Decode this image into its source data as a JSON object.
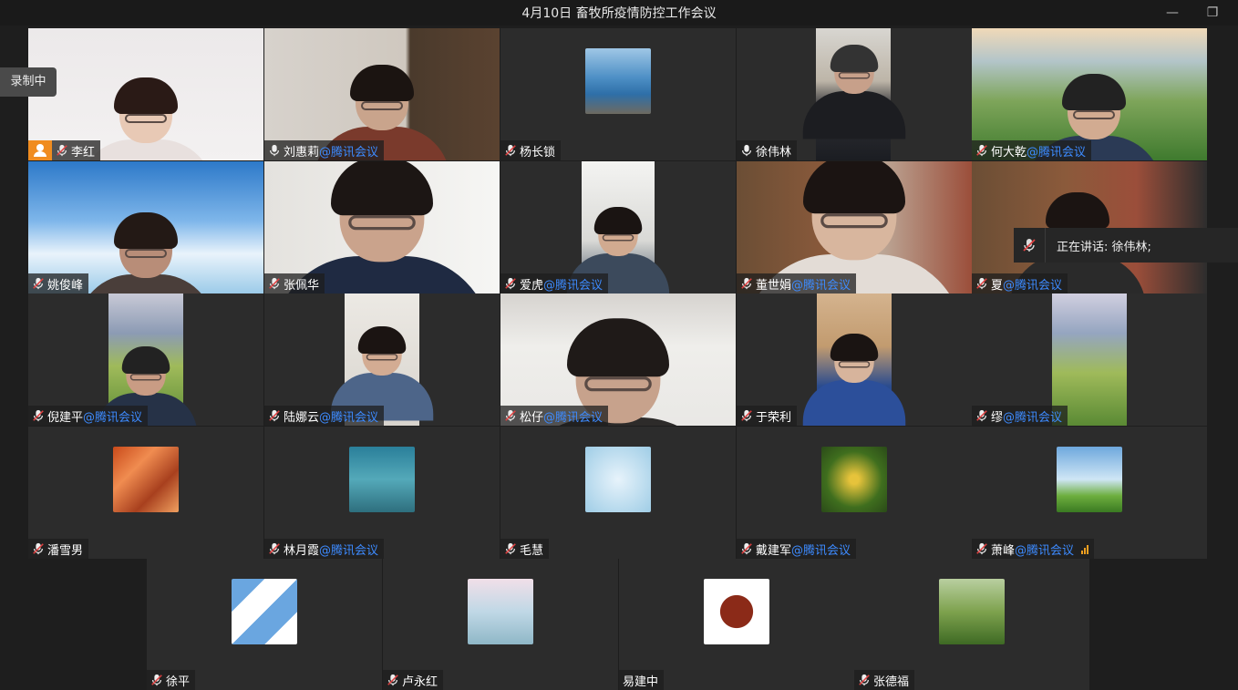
{
  "window": {
    "title": "4月10日 畜牧所疫情防控工作会议",
    "minimize_icon": "—",
    "restore_icon": "❐"
  },
  "recording": {
    "label": "录制中"
  },
  "speaking": {
    "text": "正在讲话: 徐伟林;"
  },
  "colors": {
    "active_border": "#20c36b",
    "suffix": "#3d8bff",
    "host_badge": "#f08c1f"
  },
  "participants": [
    {
      "name": "李红",
      "suffix": "",
      "mic": "muted",
      "host": true
    },
    {
      "name": "刘惠莉",
      "suffix": "@腾讯会议",
      "mic": "on"
    },
    {
      "name": "杨长锁",
      "suffix": "",
      "mic": "muted"
    },
    {
      "name": "徐伟林",
      "suffix": "",
      "mic": "on",
      "active": true
    },
    {
      "name": "何大乾",
      "suffix": "@腾讯会议",
      "mic": "muted"
    },
    {
      "name": "姚俊峰",
      "suffix": "",
      "mic": "muted"
    },
    {
      "name": "张佩华",
      "suffix": "",
      "mic": "muted"
    },
    {
      "name": "爱虎",
      "suffix": "@腾讯会议",
      "mic": "muted"
    },
    {
      "name": "董世娟",
      "suffix": "@腾讯会议",
      "mic": "muted"
    },
    {
      "name": "夏",
      "suffix": "@腾讯会议",
      "mic": "muted"
    },
    {
      "name": "倪建平",
      "suffix": "@腾讯会议",
      "mic": "muted"
    },
    {
      "name": "陆娜云",
      "suffix": "@腾讯会议",
      "mic": "muted"
    },
    {
      "name": "松仔",
      "suffix": "@腾讯会议",
      "mic": "muted"
    },
    {
      "name": "于荣利",
      "suffix": "",
      "mic": "muted"
    },
    {
      "name": "缪",
      "suffix": "@腾讯会议",
      "mic": "muted"
    },
    {
      "name": "潘雪男",
      "suffix": "",
      "mic": "muted"
    },
    {
      "name": "林月霞",
      "suffix": "@腾讯会议",
      "mic": "muted"
    },
    {
      "name": "毛慧",
      "suffix": "",
      "mic": "muted"
    },
    {
      "name": "戴建军",
      "suffix": "@腾讯会议",
      "mic": "muted"
    },
    {
      "name": "萧峰",
      "suffix": "@腾讯会议",
      "mic": "muted",
      "signal": true
    },
    {
      "name": "徐平",
      "suffix": "",
      "mic": "muted"
    },
    {
      "name": "卢永红",
      "suffix": "",
      "mic": "muted"
    },
    {
      "name": "易建中",
      "suffix": "",
      "mic": "none"
    },
    {
      "name": "张德福",
      "suffix": "",
      "mic": "muted"
    }
  ]
}
